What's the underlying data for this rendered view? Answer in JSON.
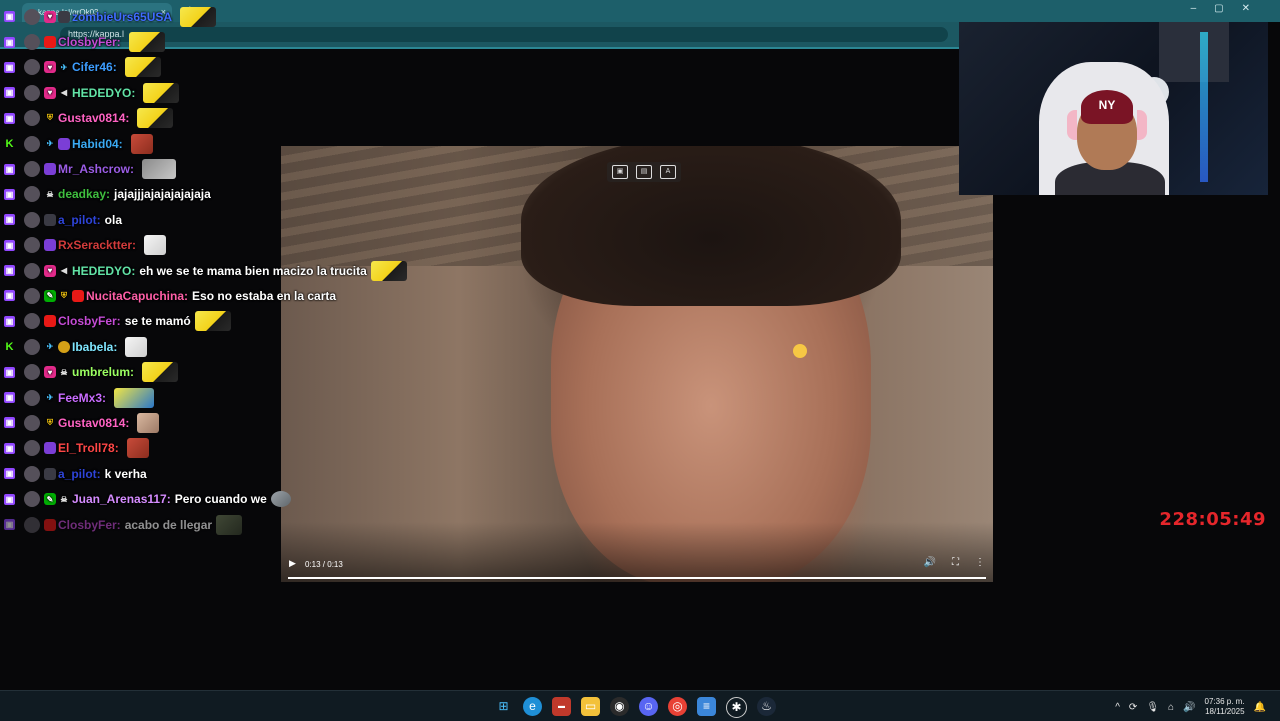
{
  "browser": {
    "tab_title": "kappa.lol/qrOk03",
    "tab_close": "×",
    "new_tab": "+",
    "address": "https://kappa.l",
    "window_controls": "–▢✕"
  },
  "chat": {
    "messages": [
      {
        "user": "zombieUrs65USA",
        "color": "#3f6cff",
        "text": "",
        "emote": true
      },
      {
        "user": "ClosbyFer:",
        "color": "#c54cd6",
        "text": "",
        "emote": true
      },
      {
        "user": "Cifer46:",
        "color": "#3d9dff",
        "text": "",
        "emote": true
      },
      {
        "user": "HEDEDYO:",
        "color": "#62e3a6",
        "text": "",
        "emote": true
      },
      {
        "user": "Gustav0814:",
        "color": "#ff63c4",
        "text": "",
        "emote": true
      },
      {
        "user": "Habid04:",
        "color": "#3aa9f2",
        "text": "",
        "emote": true
      },
      {
        "user": "Mr_Ashcrow:",
        "color": "#9b5de5",
        "text": "",
        "emote": true
      },
      {
        "user": "deadkay:",
        "color": "#3fbf3f",
        "text": "jajajjjajajajajajaja",
        "emote": false
      },
      {
        "user": "a_pilot:",
        "color": "#2e44d9",
        "text": "ola",
        "emote": false
      },
      {
        "user": "RxSeracktter:",
        "color": "#d23b3b",
        "text": "",
        "emote": true
      },
      {
        "user": "HEDEDYO:",
        "color": "#62e3a6",
        "text": "eh we se te mama bien macizo la trucita",
        "emote": true
      },
      {
        "user": "NucitaCapuchina:",
        "color": "#ff5fa8",
        "text": "Eso no estaba en la carta",
        "emote": false
      },
      {
        "user": "ClosbyFer:",
        "color": "#c54cd6",
        "text": "se te mamó",
        "emote": true
      },
      {
        "user": "Ibabela:",
        "color": "#7fe6ff",
        "text": "",
        "emote": true
      },
      {
        "user": "umbrelum:",
        "color": "#9bff62",
        "text": "",
        "emote": true
      },
      {
        "user": "FeeMx3:",
        "color": "#c96cff",
        "text": "",
        "emote": true
      },
      {
        "user": "Gustav0814:",
        "color": "#ff63c4",
        "text": "",
        "emote": true
      },
      {
        "user": "El_Troll78:",
        "color": "#ff4747",
        "text": "",
        "emote": true
      },
      {
        "user": "a_pilot:",
        "color": "#2e44d9",
        "text": "k verha",
        "emote": false
      },
      {
        "user": "Juan_Arenas117:",
        "color": "#d58cff",
        "text": "Pero cuando we",
        "emote": true
      },
      {
        "user": "ClosbyFer:",
        "color": "#c54cd6",
        "text": "acabo de llegar",
        "emote": true
      }
    ]
  },
  "video": {
    "time": "0:13 / 0:13",
    "progress": 1.0,
    "play_icon": "▶",
    "volume_icon": "🔊",
    "fullscreen_icon": "⛶",
    "more_icon": "⋮"
  },
  "webcam": {
    "cap_logo": "NY"
  },
  "timer": {
    "value": "228:05:49",
    "color": "#e5262b"
  },
  "taskbar": {
    "apps": [
      "windows-start",
      "edge",
      "media-app",
      "file-explorer",
      "obs",
      "discord",
      "chrome",
      "notepad",
      "game-app",
      "steam"
    ],
    "tray": [
      "^",
      "⟳",
      "🎙",
      "⌂",
      "🔊"
    ],
    "time": "07:36 p. m.",
    "date": "18/11/2025",
    "notification_icon": "🔔"
  }
}
